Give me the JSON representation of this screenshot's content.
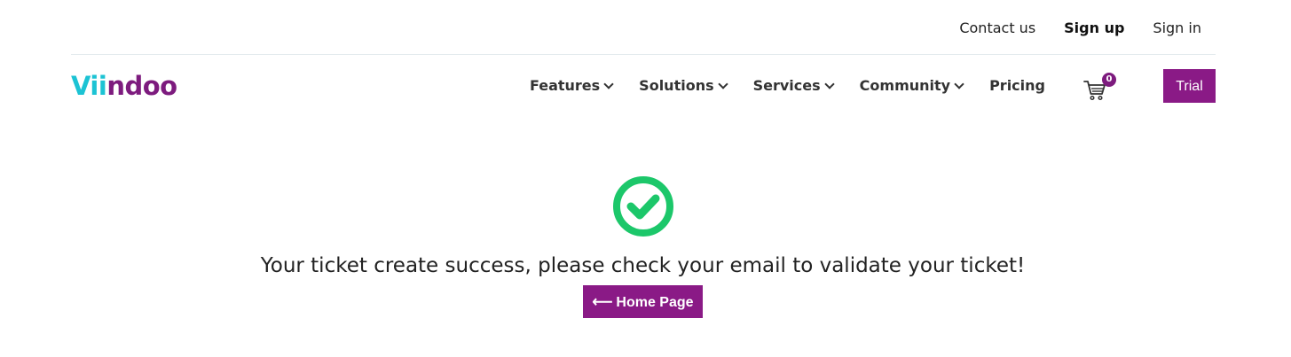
{
  "top_links": {
    "contact": "Contact us",
    "signup": "Sign up",
    "signin": "Sign in"
  },
  "logo": {
    "part1": "Vii",
    "part2": "ndoo"
  },
  "nav": {
    "features": "Features",
    "solutions": "Solutions",
    "services": "Services",
    "community": "Community",
    "pricing": "Pricing",
    "cart_count": "0",
    "trial": "Trial"
  },
  "main": {
    "message": "Your ticket create success, please check your email to validate your ticket!",
    "home_arrow": "⟵",
    "home_label": "Home Page"
  },
  "colors": {
    "brand_purple": "#8a1a86",
    "logo_cyan": "#1cc3d4",
    "success_green": "#1cc76a"
  },
  "icons": {
    "cart": "cart-icon",
    "success": "check-circle-icon"
  }
}
